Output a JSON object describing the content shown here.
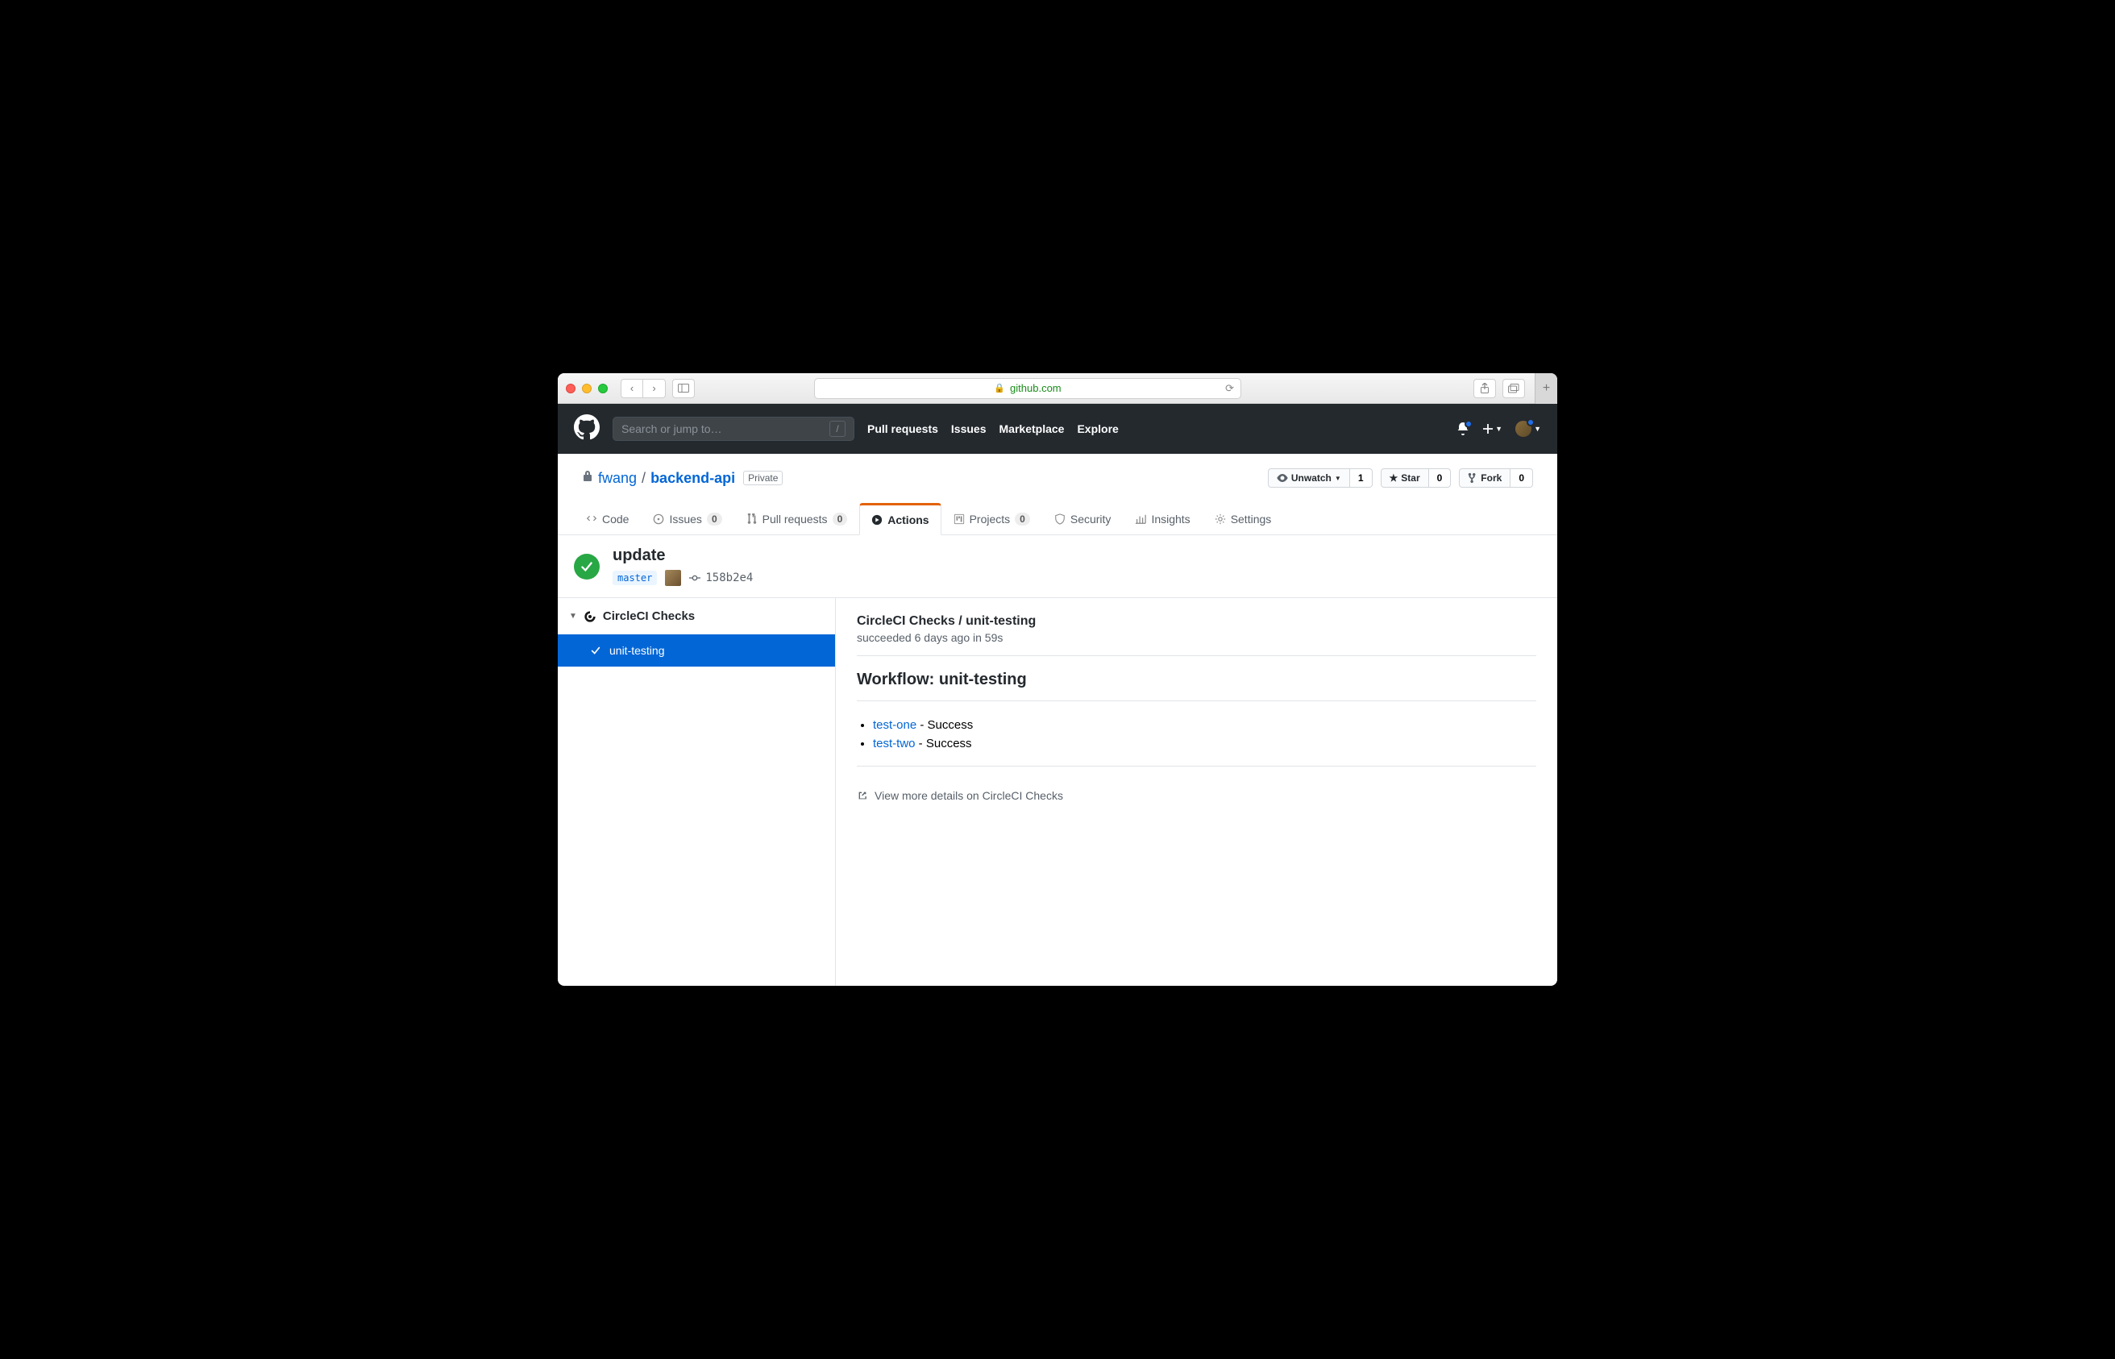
{
  "browser": {
    "url_host": "github.com"
  },
  "gh_header": {
    "search_placeholder": "Search or jump to…",
    "nav": {
      "pulls": "Pull requests",
      "issues": "Issues",
      "marketplace": "Marketplace",
      "explore": "Explore"
    }
  },
  "repo": {
    "owner": "fwang",
    "sep": "/",
    "name": "backend-api",
    "visibility": "Private",
    "actions": {
      "watch_label": "Unwatch",
      "watch_count": "1",
      "star_label": "Star",
      "star_count": "0",
      "fork_label": "Fork",
      "fork_count": "0"
    }
  },
  "tabs": {
    "code": "Code",
    "issues": "Issues",
    "issues_count": "0",
    "pulls": "Pull requests",
    "pulls_count": "0",
    "actions": "Actions",
    "projects": "Projects",
    "projects_count": "0",
    "security": "Security",
    "insights": "Insights",
    "settings": "Settings"
  },
  "commit": {
    "title": "update",
    "branch": "master",
    "sha": "158b2e4"
  },
  "sidebar": {
    "group": "CircleCI Checks",
    "item": "unit-testing"
  },
  "detail": {
    "breadcrumb": "CircleCI Checks / unit-testing",
    "status_line": "succeeded 6 days ago in 59s",
    "workflow_label": "Workflow: unit-testing",
    "tests": [
      {
        "name": "test-one",
        "result": " - Success"
      },
      {
        "name": "test-two",
        "result": " - Success"
      }
    ],
    "view_more": "View more details on CircleCI Checks"
  }
}
